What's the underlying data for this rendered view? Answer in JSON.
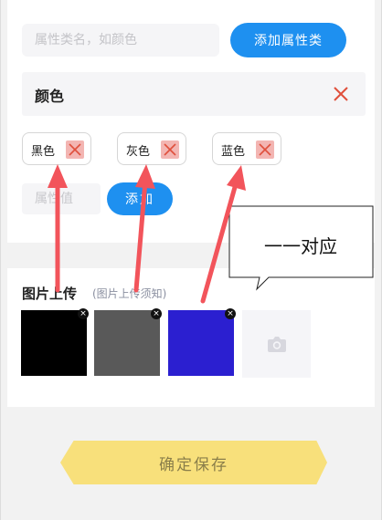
{
  "category_input": {
    "placeholder": "属性类名，如颜色"
  },
  "add_category_button": {
    "label": "添加属性类"
  },
  "category": {
    "title": "颜色"
  },
  "tags": [
    {
      "label": "黑色"
    },
    {
      "label": "灰色"
    },
    {
      "label": "蓝色"
    }
  ],
  "value_input": {
    "placeholder": "属性值"
  },
  "add_value_button": {
    "label": "添加"
  },
  "annotation": {
    "text": "一一对应"
  },
  "upload": {
    "title": "图片上传",
    "hint": "(图片上传须知)",
    "images": [
      {
        "color": "#000000",
        "close": "×"
      },
      {
        "color": "#595959",
        "close": "×"
      },
      {
        "color": "#2b1fd0",
        "close": "×"
      }
    ],
    "add_icon": "camera-icon"
  },
  "save_button": {
    "label": "确定保存"
  },
  "colors": {
    "primary": "#1e90f0",
    "delete_red": "#e0503c",
    "tag_delete_bg": "#f3b5b2",
    "annotation_arrow": "#f2545b",
    "save_bg": "#f8e07b"
  }
}
